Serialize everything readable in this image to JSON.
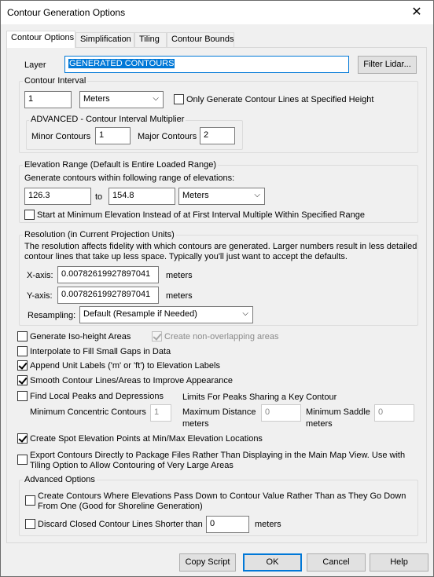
{
  "window": {
    "title": "Contour Generation Options",
    "close_glyph": "✕"
  },
  "tabs": [
    "Contour Options",
    "Simplification",
    "Tiling",
    "Contour Bounds"
  ],
  "layer": {
    "label": "Layer",
    "value": "GENERATED CONTOURS",
    "filter_button": "Filter Lidar..."
  },
  "contour_interval": {
    "group_label": "Contour Interval",
    "value": "1",
    "unit": "Meters",
    "only_specified_height": {
      "label": "Only Generate Contour Lines at Specified Height",
      "checked": false
    },
    "advanced": {
      "group_label": "ADVANCED - Contour Interval Multiplier",
      "minor_label": "Minor Contours",
      "minor_value": "1",
      "major_label": "Major Contours",
      "major_value": "2"
    }
  },
  "elevation_range": {
    "group_label": "Elevation Range (Default is Entire Loaded Range)",
    "description": "Generate contours within following range of elevations:",
    "from": "126.3",
    "to_label": "to",
    "to": "154.8",
    "unit": "Meters",
    "start_at_min": {
      "label": "Start at Minimum Elevation Instead of at First Interval Multiple Within Specified Range",
      "checked": false
    }
  },
  "resolution": {
    "group_label": "Resolution (in Current Projection Units)",
    "description": "The resolution affects fidelity with which contours are generated. Larger numbers result in less detailed contour lines that take up less space. Typically you'll just want to accept the defaults.",
    "x_label": "X-axis:",
    "x_value": "0.00782619927897041",
    "x_unit": "meters",
    "y_label": "Y-axis:",
    "y_value": "0.00782619927897041",
    "y_unit": "meters",
    "resampling_label": "Resampling:",
    "resampling_value": "Default (Resample if Needed)"
  },
  "options": {
    "iso_height": {
      "label": "Generate Iso-height Areas",
      "checked": false
    },
    "non_overlapping": {
      "label": "Create non-overlapping areas",
      "checked": true,
      "disabled": true
    },
    "interpolate": {
      "label": "Interpolate to Fill Small Gaps in Data",
      "checked": false
    },
    "append_unit": {
      "label": "Append Unit Labels ('m' or 'ft') to Elevation Labels",
      "checked": true
    },
    "smooth": {
      "label": "Smooth Contour Lines/Areas to Improve Appearance",
      "checked": true
    },
    "find_peaks": {
      "label": "Find Local Peaks and Depressions",
      "checked": false
    },
    "limits_label": "Limits For Peaks Sharing a Key Contour",
    "min_concentric_label": "Minimum  Concentric Contours",
    "min_concentric_value": "1",
    "max_distance_label": "Maximum Distance",
    "max_distance_unit": "meters",
    "max_distance_value": "0",
    "min_saddle_label": "Minimum Saddle",
    "min_saddle_unit": "meters",
    "min_saddle_value": "0",
    "spot_elevation": {
      "label": "Create Spot Elevation Points at Min/Max Elevation Locations",
      "checked": true
    },
    "export_package": {
      "label": "Export Contours Directly to Package Files Rather Than Displaying in the Main Map View. Use with Tiling Option to Allow Contouring of Very Large Areas",
      "checked": false
    }
  },
  "advanced_options": {
    "group_label": "Advanced Options",
    "pass_down": {
      "label": "Create Contours Where Elevations Pass Down to Contour Value Rather Than as They Go Down From One (Good for Shoreline Generation)",
      "checked": false
    },
    "discard_closed": {
      "label": "Discard Closed Contour Lines Shorter than",
      "checked": false,
      "value": "0",
      "unit": "meters"
    }
  },
  "buttons": {
    "copy_script": "Copy Script",
    "ok": "OK",
    "cancel": "Cancel",
    "help": "Help"
  },
  "icons": {
    "dropdown": "chevron-down-icon",
    "close": "close-icon"
  }
}
